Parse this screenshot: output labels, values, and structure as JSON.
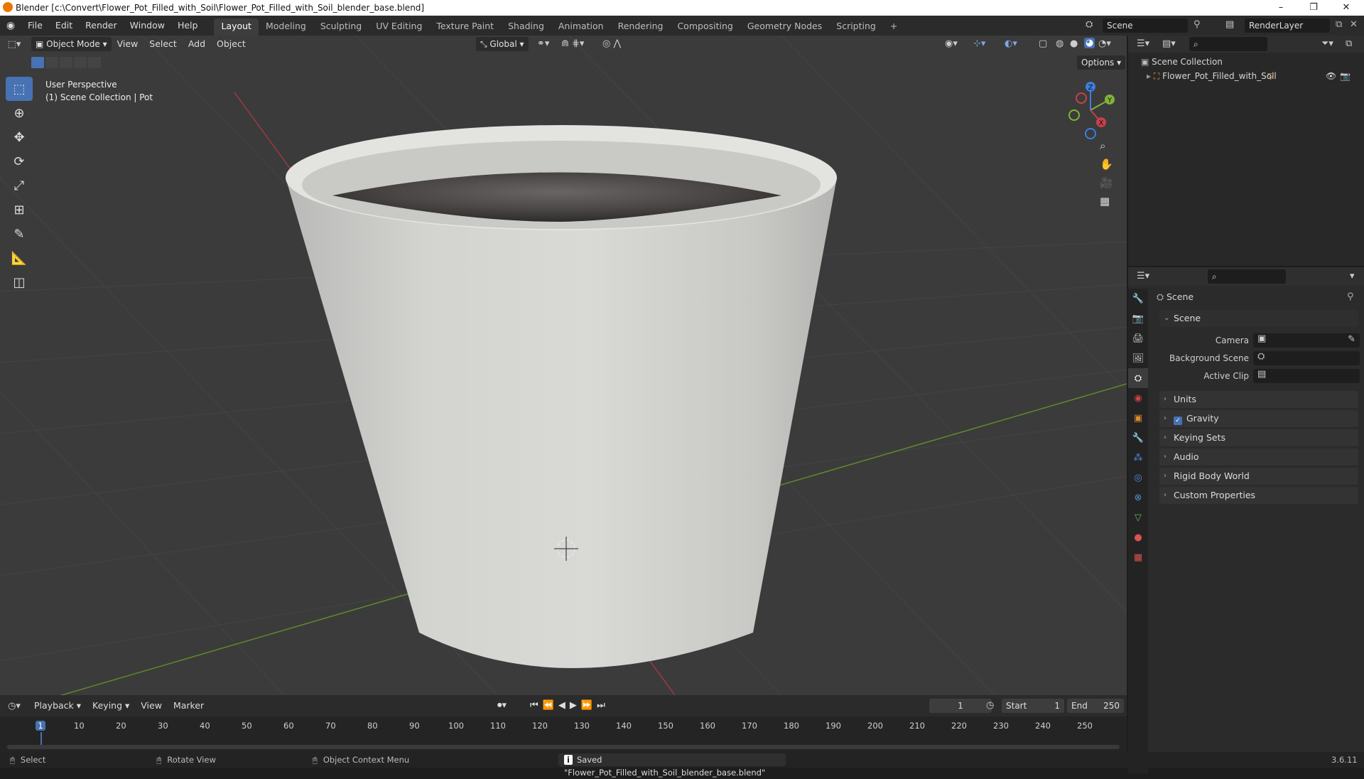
{
  "window": {
    "title": "Blender [c:\\Convert\\Flower_Pot_Filled_with_Soil\\Flower_Pot_Filled_with_Soil_blender_base.blend]",
    "minimize": "–",
    "maximize": "❐",
    "close": "✕"
  },
  "menu": {
    "items": [
      "File",
      "Edit",
      "Render",
      "Window",
      "Help"
    ]
  },
  "workspaces": {
    "tabs": [
      "Layout",
      "Modeling",
      "Sculpting",
      "UV Editing",
      "Texture Paint",
      "Shading",
      "Animation",
      "Rendering",
      "Compositing",
      "Geometry Nodes",
      "Scripting"
    ],
    "active": "Layout",
    "add": "+"
  },
  "scene_selector": {
    "scene": "Scene",
    "layer": "RenderLayer"
  },
  "viewport": {
    "mode": "Object Mode",
    "menus": [
      "View",
      "Select",
      "Add",
      "Object"
    ],
    "orientation": "Global",
    "options": "Options",
    "overlay_line1": "User Perspective",
    "overlay_line2": "(1) Scene Collection | Pot",
    "gizmo": {
      "x": "X",
      "y": "Y",
      "z": "Z"
    }
  },
  "outliner": {
    "root": "Scene Collection",
    "items": [
      {
        "name": "Flower_Pot_Filled_with_Soil"
      }
    ]
  },
  "properties": {
    "context_title": "Scene",
    "panel_scene": "Scene",
    "camera_label": "Camera",
    "bg_scene_label": "Background Scene",
    "active_clip_label": "Active Clip",
    "panels": [
      "Units",
      "Gravity",
      "Keying Sets",
      "Audio",
      "Rigid Body World",
      "Custom Properties"
    ]
  },
  "timeline": {
    "menus": [
      "Playback",
      "Keying",
      "View",
      "Marker"
    ],
    "current_frame": "1",
    "start_label": "Start",
    "start": "1",
    "end_label": "End",
    "end": "250",
    "ticks": [
      "1",
      "10",
      "20",
      "30",
      "40",
      "50",
      "60",
      "70",
      "80",
      "90",
      "100",
      "110",
      "120",
      "130",
      "140",
      "150",
      "160",
      "170",
      "180",
      "190",
      "200",
      "210",
      "220",
      "230",
      "240",
      "250"
    ]
  },
  "status": {
    "select": "Select",
    "rotate": "Rotate View",
    "context_menu": "Object Context Menu",
    "message": "Saved \"Flower_Pot_Filled_with_Soil_blender_base.blend\"",
    "version": "3.6.11"
  },
  "colors": {
    "accent": "#4772b3",
    "x_axis": "#c8414a",
    "y_axis": "#7fb336",
    "z_axis": "#3e7de0"
  }
}
